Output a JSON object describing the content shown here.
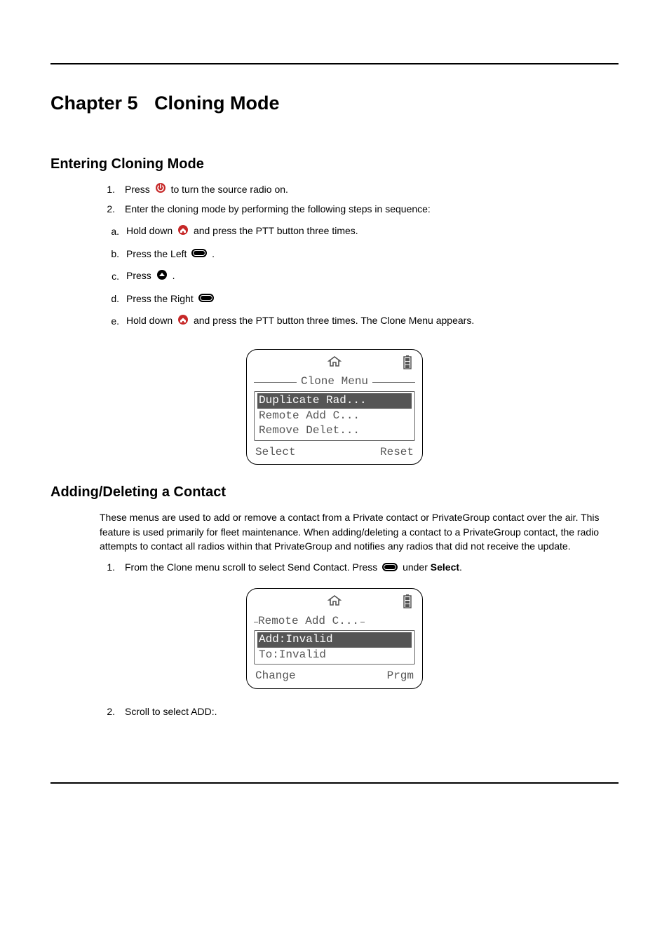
{
  "chapter": {
    "prefix": "Chapter 5",
    "title": "Cloning Mode"
  },
  "section1": {
    "heading": "Entering Cloning Mode",
    "step1": {
      "num": "1.",
      "pre": "Press",
      "post": "to turn the source radio on."
    },
    "step2": {
      "num": "2.",
      "text": "Enter the cloning mode by performing the following steps in sequence:"
    },
    "sub": {
      "a": {
        "num": "a.",
        "pre": "Hold down",
        "post": "and press the PTT button three times."
      },
      "b": {
        "num": "b.",
        "pre": "Press the Left",
        "post": "."
      },
      "c": {
        "num": "c.",
        "pre": "Press",
        "post": "."
      },
      "d": {
        "num": "d.",
        "pre": "Press the Right"
      },
      "e": {
        "num": "e.",
        "pre": "Hold down",
        "post": "and press the PTT button three times. The Clone Menu appears."
      }
    },
    "screen": {
      "title": "Clone Menu",
      "items": [
        "Duplicate Rad...",
        "Remote Add C...",
        "Remove Delet..."
      ],
      "soft_left": "Select",
      "soft_right": "Reset"
    }
  },
  "section2": {
    "heading": "Adding/Deleting a Contact",
    "body": "These menus are used to add or remove a contact from a Private contact or PrivateGroup contact over the air. This feature is used primarily for fleet maintenance. When adding/deleting a contact to a PrivateGroup contact, the radio attempts to contact all radios within that PrivateGroup and notifies any radios that did not receive the update.",
    "step1": {
      "num": "1.",
      "pre": "From the Clone menu scroll to select Send Contact. Press",
      "post_pre": "under",
      "post_bold": "Select",
      "post_end": "."
    },
    "screen": {
      "title": "Remote Add C...",
      "items": [
        "Add:Invalid",
        "To:Invalid"
      ],
      "soft_left": "Change",
      "soft_right": "Prgm"
    },
    "step2": {
      "num": "2.",
      "text": "Scroll to select ADD:."
    }
  },
  "icons": {
    "power": "power-icon",
    "home": "home-icon",
    "soft": "softkey-icon",
    "up": "up-arrow-icon",
    "house": "house-icon",
    "battery": "battery-icon"
  }
}
